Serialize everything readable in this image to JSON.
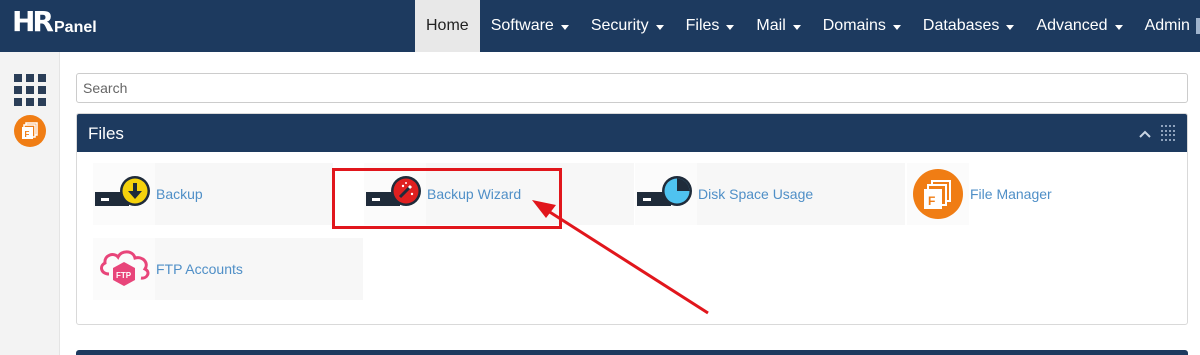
{
  "brand": {
    "mark": "HR",
    "name": "Panel"
  },
  "nav": {
    "items": [
      {
        "label": "Home",
        "active": true,
        "dropdown": false
      },
      {
        "label": "Software",
        "dropdown": true
      },
      {
        "label": "Security",
        "dropdown": true
      },
      {
        "label": "Files",
        "dropdown": true
      },
      {
        "label": "Mail",
        "dropdown": true
      },
      {
        "label": "Domains",
        "dropdown": true
      },
      {
        "label": "Databases",
        "dropdown": true
      },
      {
        "label": "Advanced",
        "dropdown": true
      },
      {
        "label": "Admin",
        "dropdown": true
      }
    ]
  },
  "sidebar": {
    "icons": [
      "apps-grid-icon",
      "file-manager-icon"
    ]
  },
  "search": {
    "placeholder": "Search",
    "value": ""
  },
  "files_panel": {
    "title": "Files",
    "items": [
      {
        "label": "Backup",
        "icon": "backup-icon"
      },
      {
        "label": "Backup Wizard",
        "icon": "backup-wizard-icon"
      },
      {
        "label": "Disk Space Usage",
        "icon": "disk-space-icon"
      },
      {
        "label": "File Manager",
        "icon": "file-manager-icon"
      },
      {
        "label": "FTP Accounts",
        "icon": "ftp-accounts-icon"
      }
    ]
  },
  "colors": {
    "navbar": "#1d3a5f",
    "link": "#4f8fc7",
    "annotation": "#e1161c",
    "file_manager": "#f07d14",
    "ftp": "#e8457a"
  }
}
